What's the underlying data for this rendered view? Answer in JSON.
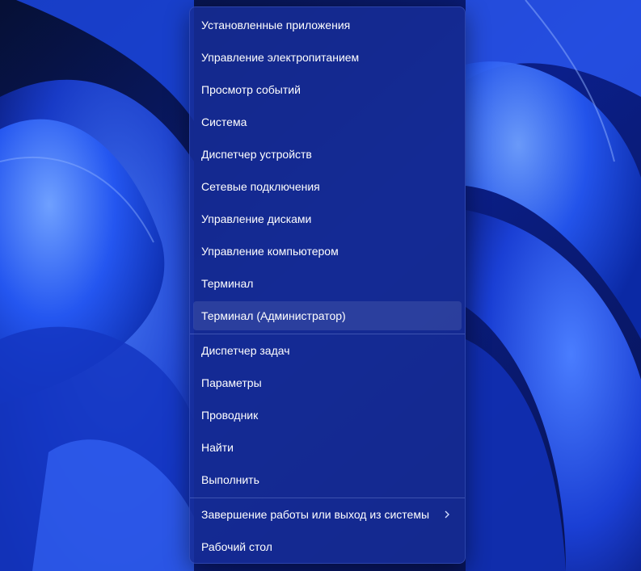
{
  "menu": {
    "items": [
      {
        "label": "Установленные приложения"
      },
      {
        "label": "Управление электропитанием"
      },
      {
        "label": "Просмотр событий"
      },
      {
        "label": "Система"
      },
      {
        "label": "Диспетчер устройств"
      },
      {
        "label": "Сетевые подключения"
      },
      {
        "label": "Управление дисками"
      },
      {
        "label": "Управление компьютером"
      },
      {
        "label": "Терминал"
      },
      {
        "label": "Терминал (Администратор)"
      },
      {
        "label": "Диспетчер задач"
      },
      {
        "label": "Параметры"
      },
      {
        "label": "Проводник"
      },
      {
        "label": "Найти"
      },
      {
        "label": "Выполнить"
      },
      {
        "label": "Завершение работы или выход из системы",
        "icon": "chevron-right-icon"
      },
      {
        "label": "Рабочий стол"
      }
    ]
  },
  "colors": {
    "menu_background": "#162c96",
    "text": "#ffffff",
    "separator": "#aabeff",
    "wallpaper_accent": "#1f4dff"
  }
}
